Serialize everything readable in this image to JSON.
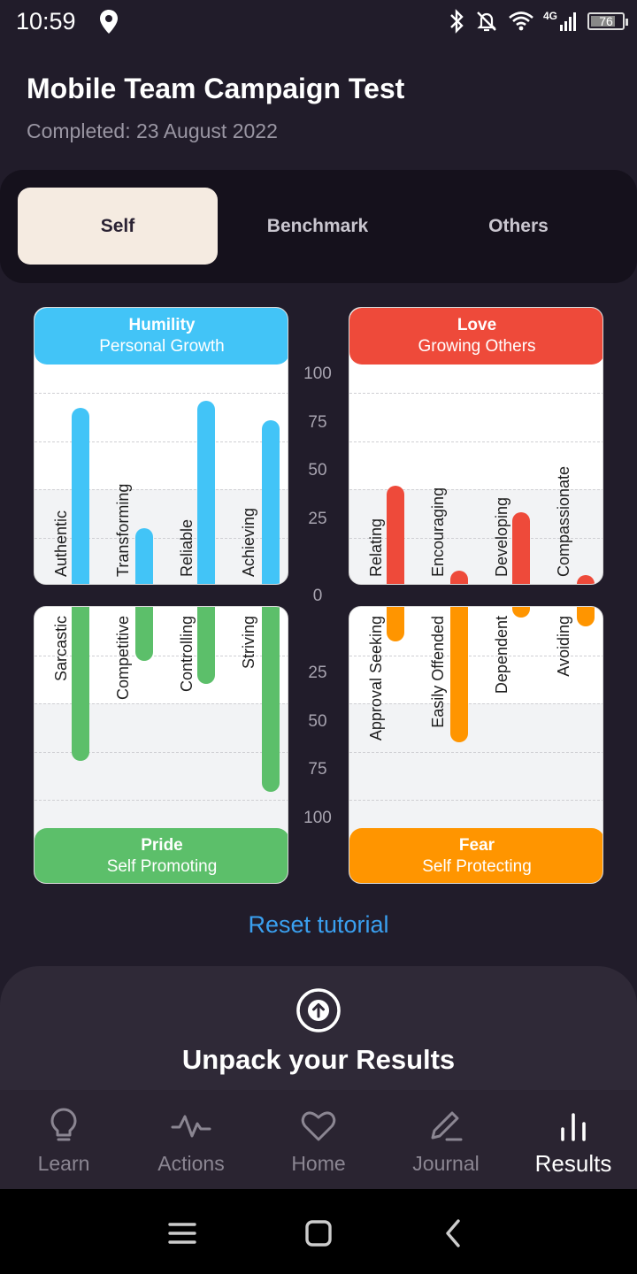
{
  "status_bar": {
    "time": "10:59",
    "battery": "76",
    "network": "4G"
  },
  "header": {
    "title": "Mobile Team Campaign Test",
    "subtitle": "Completed: 23 August 2022"
  },
  "tabs": [
    {
      "label": "Self",
      "active": true
    },
    {
      "label": "Benchmark",
      "active": false
    },
    {
      "label": "Others",
      "active": false
    }
  ],
  "chart_data": {
    "type": "bar",
    "axis_upper_ticks": [
      "100",
      "75",
      "50",
      "25"
    ],
    "axis_zero": "0",
    "axis_lower_ticks": [
      "25",
      "50",
      "75",
      "100"
    ],
    "ylim": [
      0,
      100
    ],
    "quadrants": [
      {
        "title": "Humility",
        "subtitle": "Personal Growth",
        "color": "#42c4f7",
        "categories": [
          "Authentic",
          "Transforming",
          "Reliable",
          "Achieving"
        ],
        "values": [
          92,
          30,
          96,
          86
        ]
      },
      {
        "title": "Love",
        "subtitle": "Growing Others",
        "color": "#ee4a3a",
        "categories": [
          "Relating",
          "Encouraging",
          "Developing",
          "Compassionate"
        ],
        "values": [
          52,
          8,
          38,
          4
        ]
      },
      {
        "title": "Pride",
        "subtitle": "Self Promoting",
        "color": "#5cbf6a",
        "categories": [
          "Sarcastic",
          "Competitive",
          "Controlling",
          "Striving"
        ],
        "values": [
          80,
          28,
          40,
          96
        ]
      },
      {
        "title": "Fear",
        "subtitle": "Self Protecting",
        "color": "#ff9500",
        "categories": [
          "Approval Seeking",
          "Easily Offended",
          "Dependent",
          "Avoiding"
        ],
        "values": [
          18,
          70,
          2,
          10
        ]
      }
    ]
  },
  "reset_link": "Reset tutorial",
  "unpack": {
    "title": "Unpack your Results",
    "icon": "upload-circle-icon"
  },
  "nav": [
    {
      "label": "Learn",
      "icon": "lightbulb-icon"
    },
    {
      "label": "Actions",
      "icon": "pulse-icon"
    },
    {
      "label": "Home",
      "icon": "heart-icon"
    },
    {
      "label": "Journal",
      "icon": "pencil-icon"
    },
    {
      "label": "Results",
      "icon": "bar-chart-icon",
      "active": true
    }
  ]
}
